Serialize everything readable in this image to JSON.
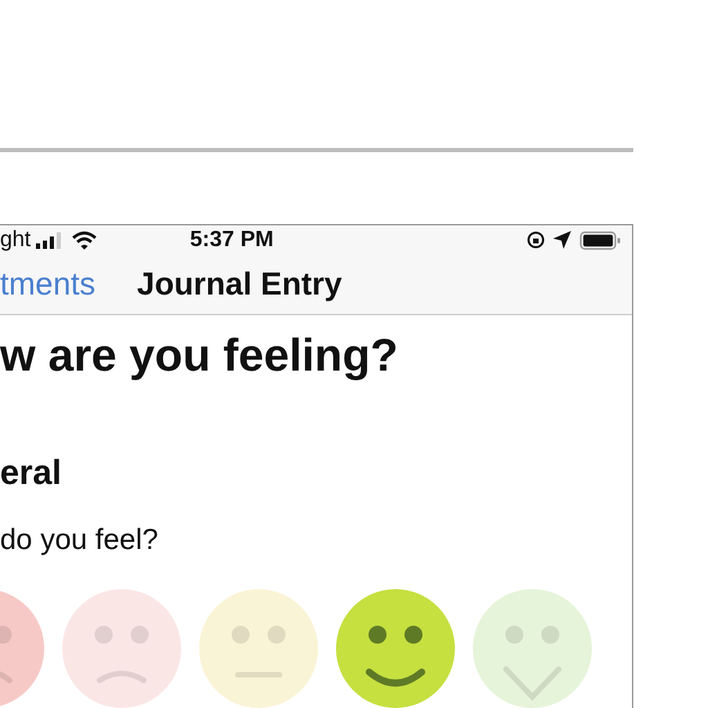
{
  "status_bar": {
    "carrier": "ght",
    "time": "5:37 PM"
  },
  "nav_bar": {
    "back_label": "tments",
    "title": "Journal Entry"
  },
  "heading": "w are you feeling?",
  "section": {
    "title": "eral",
    "question": "do you feel?"
  },
  "moods": [
    {
      "kind": "very-sad",
      "color": "#f6c9c6",
      "selected": false
    },
    {
      "kind": "sad",
      "color": "#fbe6e6",
      "selected": false
    },
    {
      "kind": "neutral",
      "color": "#faf4d6",
      "selected": false
    },
    {
      "kind": "happy",
      "color": "#c5e03f",
      "selected": true
    },
    {
      "kind": "very-happy",
      "color": "#e6f4d9",
      "selected": false
    }
  ]
}
